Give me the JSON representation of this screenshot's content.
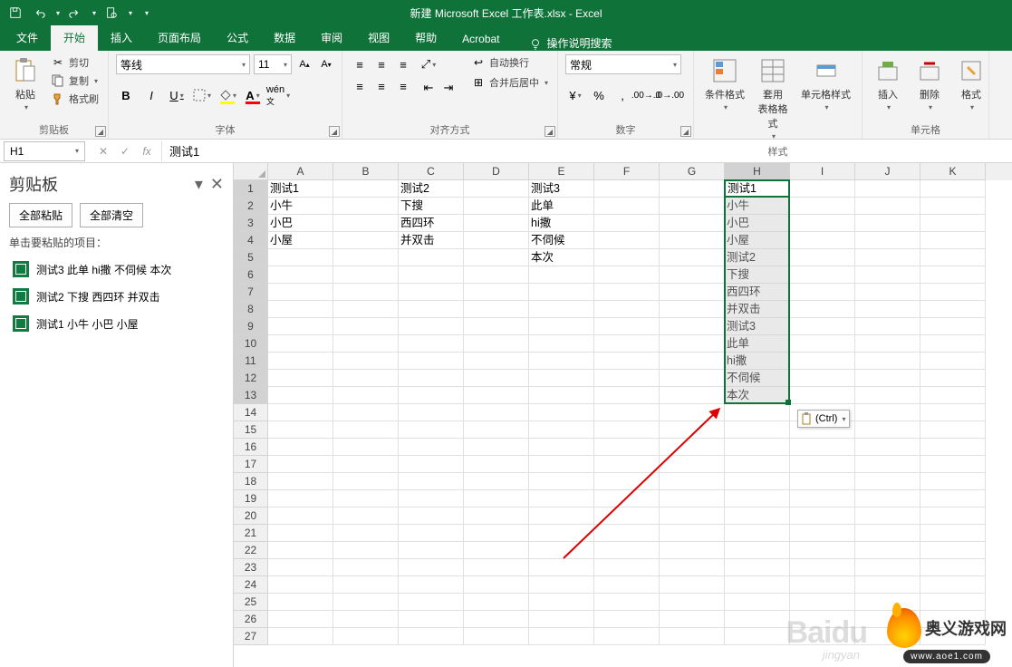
{
  "window": {
    "title": "新建 Microsoft Excel 工作表.xlsx  -  Excel"
  },
  "tabs": {
    "file": "文件",
    "home": "开始",
    "insert": "插入",
    "layout": "页面布局",
    "formula": "公式",
    "data": "数据",
    "review": "审阅",
    "view": "视图",
    "help": "帮助",
    "acrobat": "Acrobat",
    "search": "操作说明搜索"
  },
  "ribbon": {
    "clipboard": {
      "paste": "粘贴",
      "cut": "剪切",
      "copy": "复制",
      "painter": "格式刷",
      "group": "剪贴板"
    },
    "font": {
      "name": "等线",
      "size": "11",
      "group": "字体"
    },
    "align": {
      "wrap": "自动换行",
      "merge": "合并后居中",
      "group": "对齐方式"
    },
    "number": {
      "format": "常规",
      "group": "数字"
    },
    "styles": {
      "cond": "条件格式",
      "table": "套用\n表格格式",
      "cell": "单元格样式",
      "group": "样式"
    },
    "cells": {
      "insert": "插入",
      "delete": "删除",
      "format": "格式",
      "group": "单元格"
    }
  },
  "formula_bar": {
    "name": "H1",
    "value": "测试1"
  },
  "clipboard_pane": {
    "title": "剪贴板",
    "paste_all": "全部粘贴",
    "clear_all": "全部清空",
    "hint": "单击要粘贴的项目：",
    "items": [
      "测试3 此单 hi撒 不伺候 本次",
      "测试2 下搜 西四环 并双击",
      "测试1 小牛 小巴 小屋"
    ]
  },
  "grid": {
    "columns": [
      "A",
      "B",
      "C",
      "D",
      "E",
      "F",
      "G",
      "H",
      "I",
      "J",
      "K"
    ],
    "row_count": 27,
    "data": {
      "A1": "测试1",
      "A2": "小牛",
      "A3": "小巴",
      "A4": "小屋",
      "C1": "测试2",
      "C2": "下搜",
      "C3": "西四环",
      "C4": "并双击",
      "E1": "测试3",
      "E2": "此单",
      "E3": "hi撒",
      "E4": "不伺候",
      "E5": "本次",
      "H1": "测试1",
      "H2": "小牛",
      "H3": "小巴",
      "H4": "小屋",
      "H5": "测试2",
      "H6": "下搜",
      "H7": "西四环",
      "H8": "并双击",
      "H9": "测试3",
      "H10": "此单",
      "H11": "hi撒",
      "H12": "不伺候",
      "H13": "本次"
    },
    "selected_column": "H",
    "selected_rows": [
      1,
      13
    ],
    "active_cell": "H1",
    "paste_options_label": "(Ctrl)"
  },
  "watermarks": {
    "baidu": "Baidu",
    "baidu_sub": "jingyan",
    "site": "奥义游戏网",
    "url": "www.aoe1.com"
  }
}
